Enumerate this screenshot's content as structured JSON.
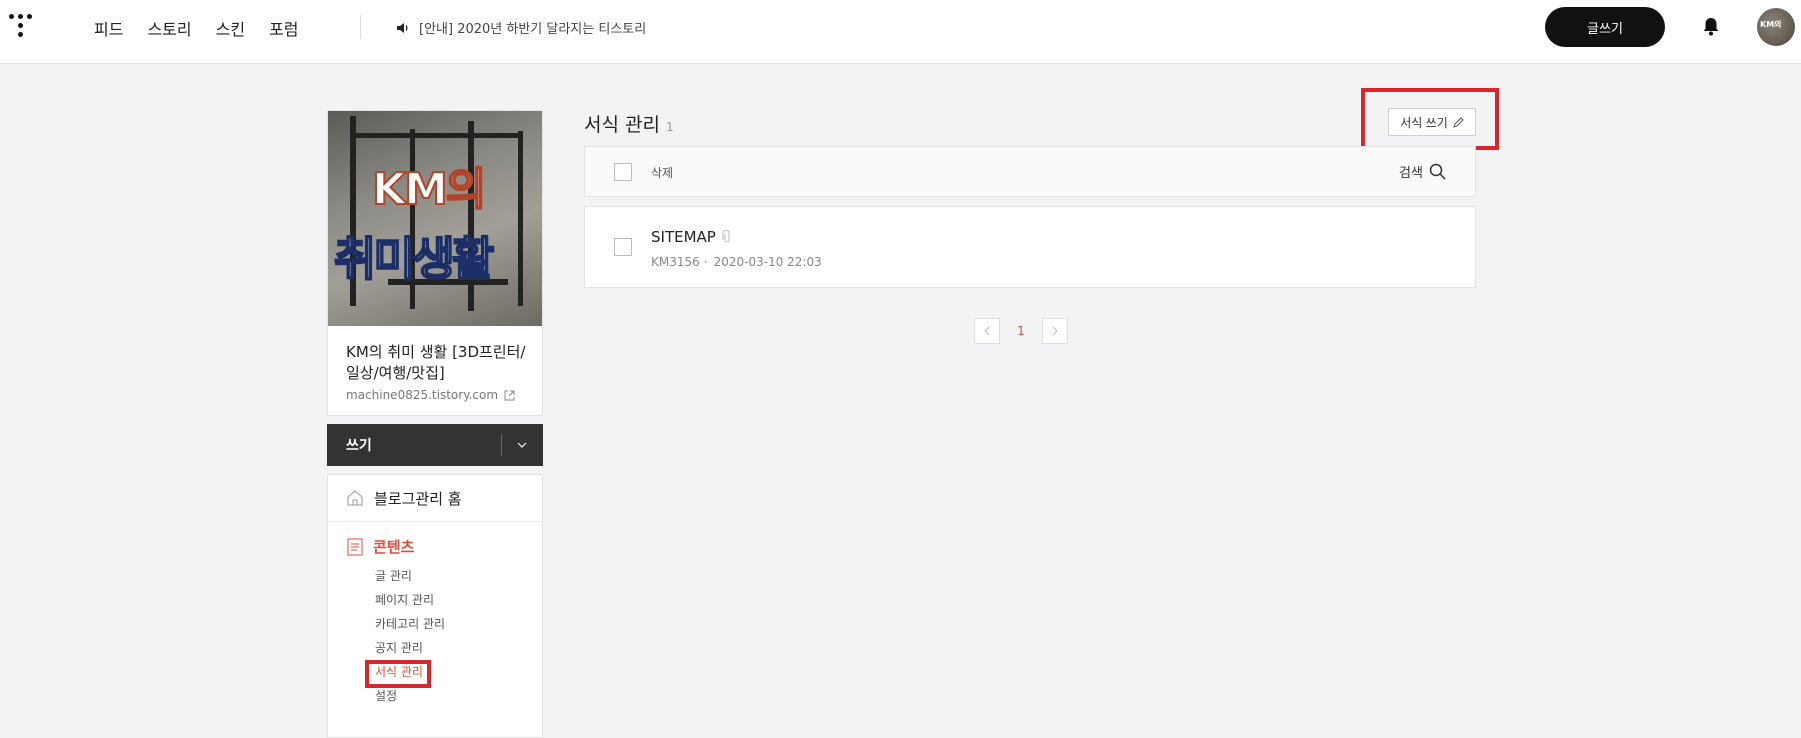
{
  "gnb": {
    "items": [
      "피드",
      "스토리",
      "스킨",
      "포럼"
    ],
    "notice": "[안내] 2020년 하반기 달라지는 티스토리",
    "write_button": "글쓰기",
    "avatar_text": "KM의"
  },
  "sidebar": {
    "cover_text_line1": "KM의",
    "cover_text_line2": "취미생활",
    "blog_name": "KM의 취미 생활 [3D프린터/일상/여행/맛집]",
    "blog_url": "machine0825.tistory.com",
    "write_label": "쓰기",
    "home_label": "블로그관리 홈",
    "section_label": "콘텐츠",
    "submenu": [
      "글 관리",
      "페이지 관리",
      "카테고리 관리",
      "공지 관리",
      "서식 관리",
      "설정"
    ]
  },
  "main": {
    "title": "서식 관리",
    "count": "1",
    "form_write_button": "서식 쓰기",
    "delete_label": "삭제",
    "search_label": "검색",
    "rows": [
      {
        "title": "SITEMAP",
        "author": "KM3156",
        "date": "2020-03-10 22:03"
      }
    ],
    "pagination": {
      "current": "1"
    }
  },
  "colors": {
    "accent": "#e04c3a",
    "highlight_box": "#d9262d",
    "dark": "#111111"
  }
}
